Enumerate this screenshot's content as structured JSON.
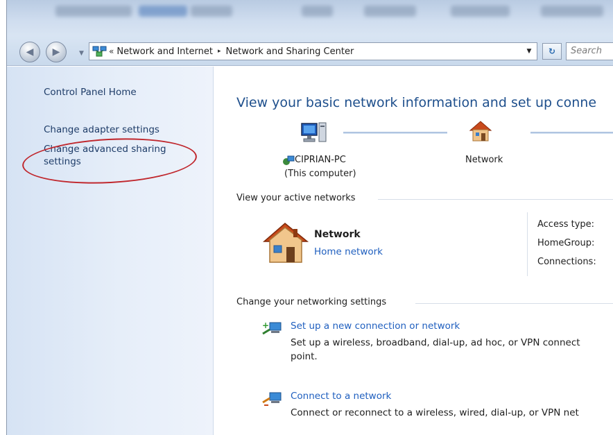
{
  "window": {
    "blurred_title_visible": true
  },
  "navigation": {
    "back_icon": "back-arrow-icon",
    "forward_icon": "forward-arrow-icon",
    "address": {
      "overflow_glyph": "«",
      "crumbs": [
        "Network and Internet",
        "Network and Sharing Center"
      ],
      "separator": "▸"
    },
    "refresh_glyph": "↻",
    "search_placeholder": "Search"
  },
  "sidebar": {
    "items": [
      {
        "label": "Control Panel Home"
      },
      {
        "label": "Change adapter settings"
      },
      {
        "label": "Change advanced sharing settings",
        "line1": "Change advanced sharing",
        "line2": "settings",
        "highlighted": true
      }
    ],
    "highlight_color": "#c0272d"
  },
  "main": {
    "heading": "View your basic network information and set up conne",
    "network_map": {
      "computer_name": "CIPRIAN-PC",
      "computer_sub": "(This computer)",
      "network_label": "Network"
    },
    "active_networks": {
      "section_title": "View your active networks",
      "network_name": "Network",
      "network_type": "Home network",
      "fields": [
        "Access type:",
        "HomeGroup:",
        "Connections:"
      ]
    },
    "change_settings": {
      "section_title": "Change your networking settings",
      "tasks": [
        {
          "link": "Set up a new connection or network",
          "desc_line1": "Set up a wireless, broadband, dial-up, ad hoc, or VPN connect",
          "desc_line2": "point."
        },
        {
          "link": "Connect to a network",
          "desc_line1": "Connect or reconnect to a wireless, wired, dial-up, or VPN net"
        }
      ]
    }
  },
  "colors": {
    "link": "#1f5fbf",
    "heading": "#1e4f8c",
    "sidebar_text": "#1e3c68"
  }
}
